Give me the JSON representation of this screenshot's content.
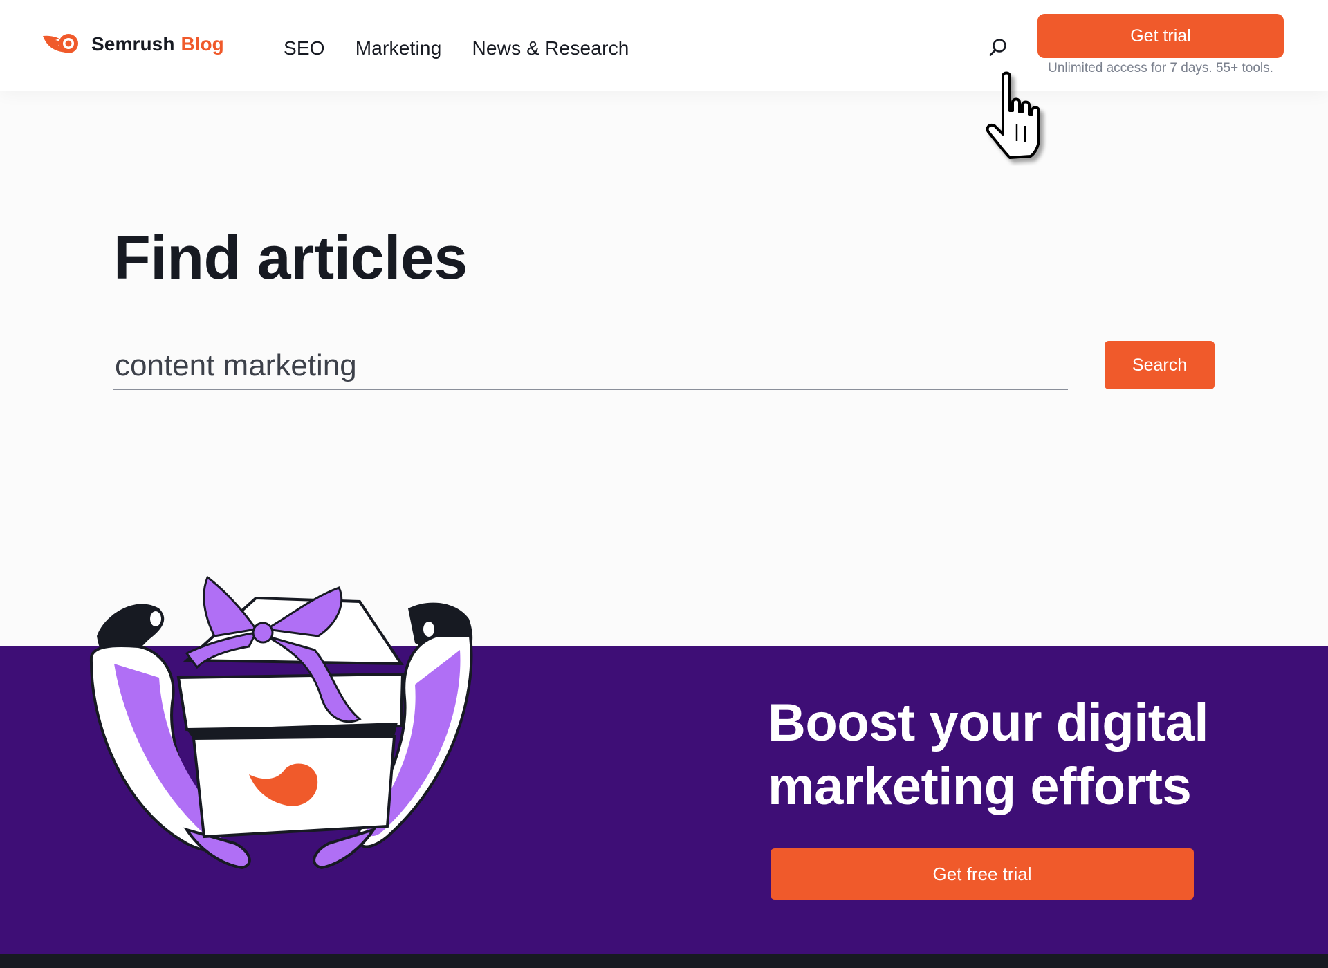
{
  "header": {
    "brand": "Semrush",
    "brand_suffix": "Blog",
    "nav": [
      {
        "label": "SEO"
      },
      {
        "label": "Marketing"
      },
      {
        "label": "News & Research"
      }
    ],
    "trial_button": "Get trial",
    "trial_note": "Unlimited access for 7 days. 55+ tools."
  },
  "find": {
    "title": "Find articles",
    "query": "content marketing",
    "search_button": "Search"
  },
  "promo": {
    "heading": "Boost your digital marketing efforts",
    "button": "Get free trial"
  },
  "colors": {
    "accent": "#f05a2b",
    "promo_bg": "#3e0e76",
    "illustration_purple": "#b06ff5",
    "text_dark": "#171a22"
  },
  "icons": [
    "semrush-logo-icon",
    "search-icon",
    "hand-pointer-cursor-icon"
  ]
}
